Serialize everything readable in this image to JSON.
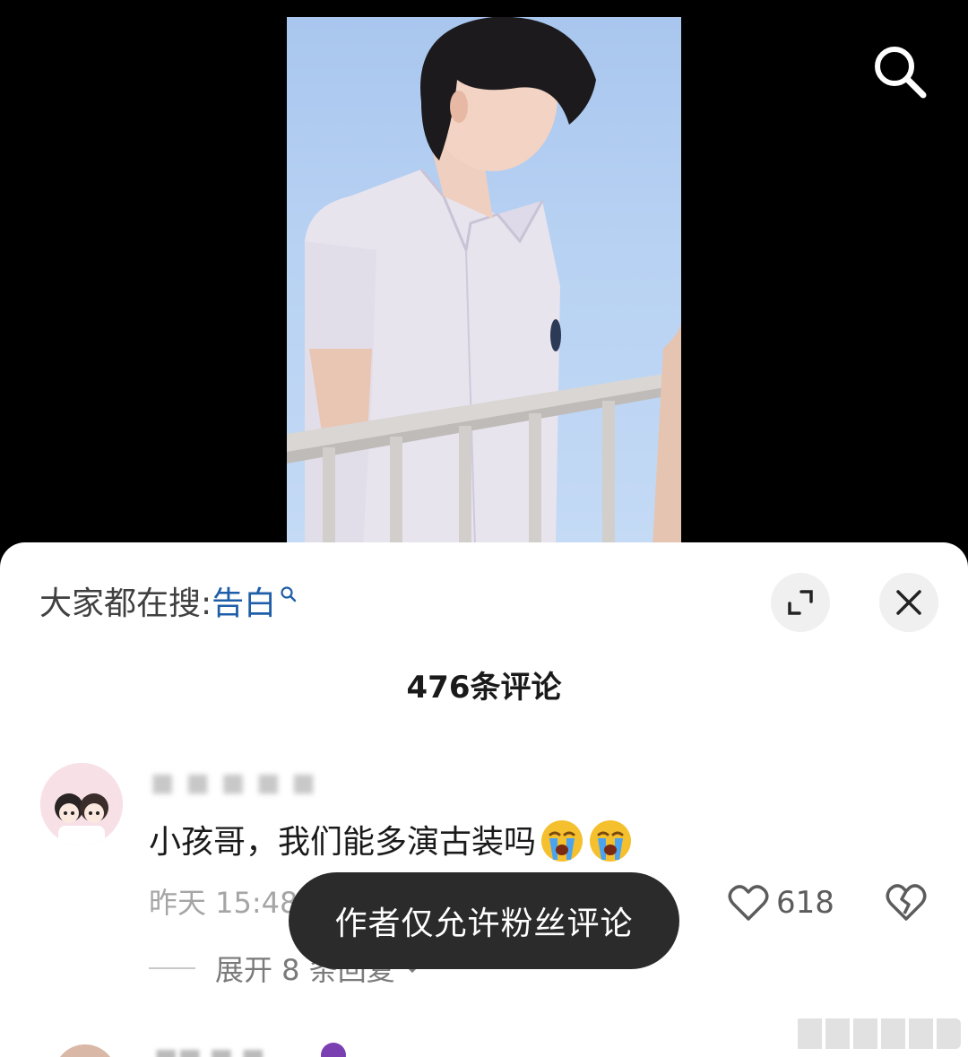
{
  "video": {
    "search_icon": "search-icon"
  },
  "panel": {
    "trending_prefix": "大家都在搜:",
    "trending_keyword": "告白",
    "expand_icon": "expand-icon",
    "close_icon": "close-icon",
    "comment_count_label": "476条评论"
  },
  "comments": [
    {
      "text": "小孩哥，我们能多演古装吗",
      "emoji": [
        "crying-face-icon",
        "crying-face-icon"
      ],
      "time": "昨天 15:48",
      "likes": "618",
      "expand_replies": "展开 8 条回复"
    }
  ],
  "toast": {
    "message": "作者仅允许粉丝评论"
  },
  "colors": {
    "keyword": "#1e5ea8",
    "toast_bg": "#2b2b2b",
    "sheet_bg": "#ffffff"
  }
}
